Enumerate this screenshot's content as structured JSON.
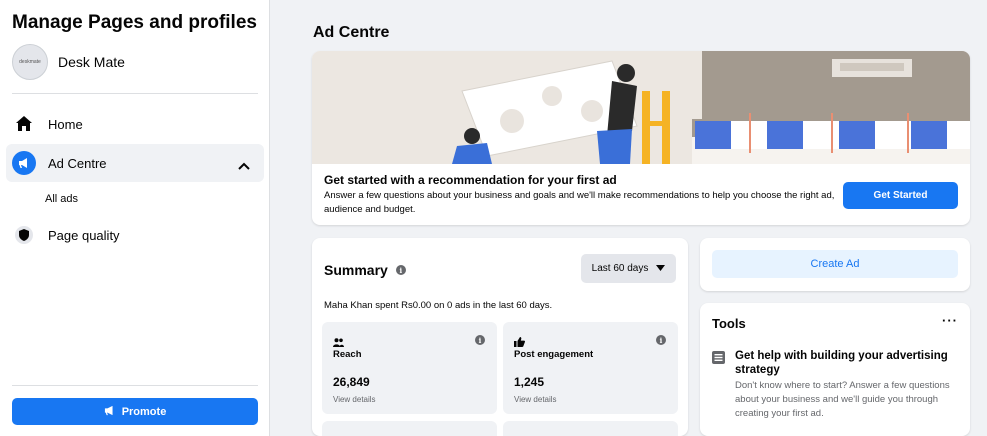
{
  "sidebar": {
    "title": "Manage Pages and profiles",
    "profile": {
      "name": "Desk Mate",
      "avatar_text": "deskmate"
    },
    "nav": [
      {
        "label": "Home",
        "icon": "home-icon"
      },
      {
        "label": "Ad Centre",
        "icon": "megaphone-icon",
        "active": true,
        "expanded": true
      },
      {
        "label": "Page quality",
        "icon": "shield-icon"
      }
    ],
    "sub_items": [
      "All ads"
    ],
    "promote_label": "Promote"
  },
  "main": {
    "title": "Ad Centre",
    "hero": {
      "heading": "Get started with a recommendation for your first ad",
      "body": "Answer a few questions about your business and goals and we'll make recommendations to help you choose the right ad, audience and budget.",
      "button_label": "Get Started"
    },
    "summary": {
      "title": "Summary",
      "range_label": "Last 60 days",
      "description": "Maha Khan spent Rs0.00 on 0 ads in the last 60 days.",
      "metrics": [
        {
          "label": "Reach",
          "value": "26,849",
          "link": "View details",
          "icon": "people-icon"
        },
        {
          "label": "Post engagement",
          "value": "1,245",
          "link": "View details",
          "icon": "thumbs-up-icon"
        }
      ]
    },
    "create_ad_label": "Create Ad",
    "tools": {
      "title": "Tools",
      "more_label": "···",
      "items": [
        {
          "heading": "Get help with building your advertising strategy",
          "body": "Don't know where to start? Answer a few questions about your business and we'll guide you through creating your first ad.",
          "icon": "list-icon"
        }
      ]
    }
  },
  "colors": {
    "accent": "#1877f2",
    "background": "#f0f2f5",
    "light_accent": "#e7f3ff"
  }
}
